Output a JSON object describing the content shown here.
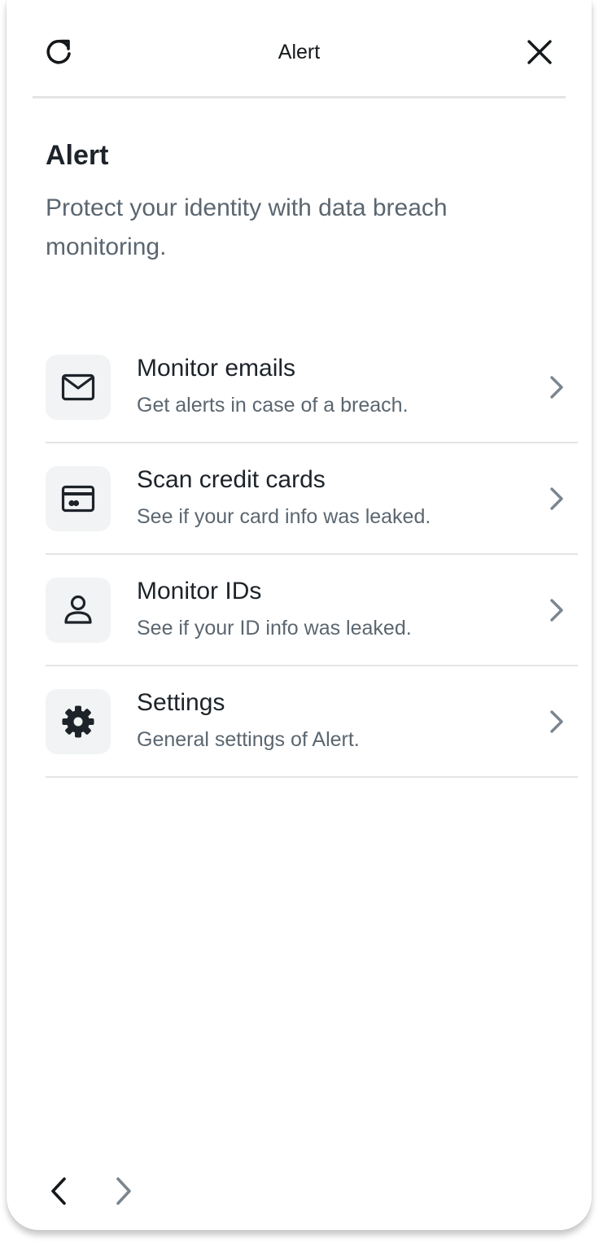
{
  "header": {
    "title": "Alert",
    "refresh_icon": "refresh-icon",
    "close_icon": "close-icon"
  },
  "main": {
    "title": "Alert",
    "description": "Protect your identity with data breach monitoring."
  },
  "items": [
    {
      "icon": "mail-icon",
      "title": "Monitor emails",
      "subtitle": "Get alerts in case of a breach."
    },
    {
      "icon": "credit-card-icon",
      "title": "Scan credit cards",
      "subtitle": "See if your card info was leaked."
    },
    {
      "icon": "person-icon",
      "title": "Monitor IDs",
      "subtitle": "See if your ID info was leaked."
    },
    {
      "icon": "gear-icon",
      "title": "Settings",
      "subtitle": "General settings of Alert."
    }
  ],
  "footer": {
    "back_icon": "chevron-left-icon",
    "forward_icon": "chevron-right-icon"
  },
  "colors": {
    "text_primary": "#1d2329",
    "text_secondary": "#5b6670",
    "icon_tile_bg": "#f1f3f4",
    "divider": "#e3e4e6",
    "chevron": "#7b858e"
  }
}
